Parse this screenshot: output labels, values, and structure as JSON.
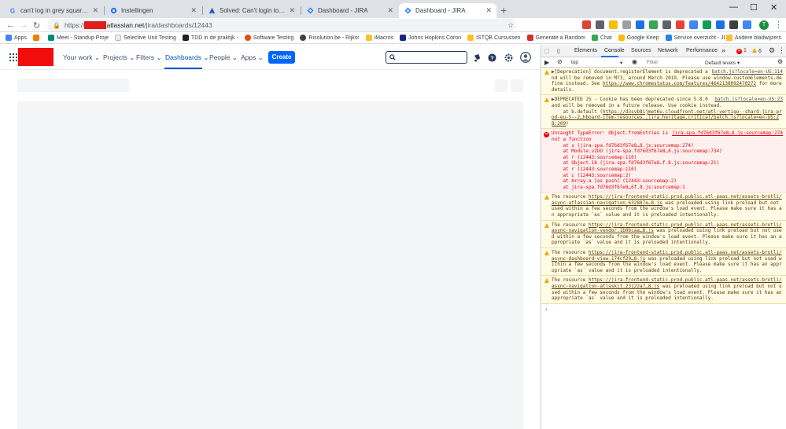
{
  "browser": {
    "tabs": [
      {
        "title": "can't log in grey squares atlassian",
        "favicon": "google-icon"
      },
      {
        "title": "Instellingen",
        "favicon": "gear-icon"
      },
      {
        "title": "Solved: Can't login to Jira (free w",
        "favicon": "atlassian-icon"
      },
      {
        "title": "Dashboard - JIRA",
        "favicon": "jira-icon"
      },
      {
        "title": "Dashboard - JIRA",
        "favicon": "jira-icon",
        "active": true
      }
    ],
    "url": {
      "scheme": "https://",
      "host_suffix": "atlassian.net",
      "path": "/jira/dashboards/12443"
    },
    "profile_initial": "T",
    "bookmarks": [
      {
        "label": "Apps",
        "color": "#4285f4"
      },
      {
        "label": "",
        "color": "#f57c00"
      },
      {
        "label": "Meet - Standup Proje",
        "color": "#00897b"
      },
      {
        "label": "Selective Unit Testing",
        "color": "#e8eaed"
      },
      {
        "label": "TDD in de praktijk -",
        "color": "#212121"
      },
      {
        "label": "Software Testing",
        "color": "#e64a19"
      },
      {
        "label": "Risolution.be - Rijksr",
        "color": "#424242"
      },
      {
        "label": "iMacros",
        "color": "#fbc02d"
      },
      {
        "label": "Johns Hopkins Coron",
        "color": "#1a237e"
      },
      {
        "label": "ISTQB Cursussen",
        "color": "#fbc02d"
      },
      {
        "label": "Generate a Random",
        "color": "#d32f2f"
      },
      {
        "label": "Chat",
        "color": "#34a853"
      },
      {
        "label": "Google Keep",
        "color": "#fbbc04"
      },
      {
        "label": "Service overzicht - JI",
        "color": "#1e88e5"
      }
    ],
    "other_bookmarks": "Andere bladwijzers"
  },
  "jira": {
    "menu": {
      "your_work": "Your work",
      "projects": "Projects",
      "filters": "Filters",
      "dashboards": "Dashboards",
      "people": "People",
      "apps": "Apps"
    },
    "create": "Create",
    "brand_color": "#0052cc"
  },
  "devtools": {
    "tabs": [
      "Elements",
      "Console",
      "Sources",
      "Network",
      "Performance"
    ],
    "active_tab": "Console",
    "more": "»",
    "error_count": "1",
    "warning_count": "6",
    "context": "top",
    "filter_placeholder": "Filter",
    "levels": "Default levels",
    "messages": [
      {
        "type": "warn",
        "source": "batch.js?locale=en-US:114",
        "text": "▶[Deprecation] document.registerElement is deprecated and will be removed in M73, around March 2019. Please use window.customElements.define instead. See ",
        "link": "https://www.chromestatus.com/features/4642138092470272",
        "tail": " for more details."
      },
      {
        "type": "warn",
        "source": "batch.js?locale=en-US:23",
        "text": "▶DEPRECATED JS - Cookie has been deprecated since 5.8.0 and will be removed in a future release. Use cookie instead.\n    at b.default (",
        "link": "https://d3svb8ijmet6u.cloudfront.net/atl-vertigo--shard-jira-prod-eu-5--2…hboard-item-resources.,jira.heritage.critical/batch.js?locale=en-US:28:209",
        "tail": ")"
      },
      {
        "type": "err",
        "source": "jira-spa.fd76d3f67e8…8.js:sourcemap:274",
        "text": "Uncaught TypeError: Object.fromEntries is not a function\n    at s (jira-spa.fd76d3f67e8…8.js:sourcemap:274)\n    at Module.vZUO (jira-spa.fd76d3f67e8…8.js:sourcemap:734)\n    at r (12443:sourcemap:110)\n    at Object.18 (jira-spa.fd76d3f67e8…f.8.js:sourcemap:21)\n    at r (12443:sourcemap:110)\n    at c (12443:sourcemap:2)\n    at Array.a [as push] (12443:sourcemap:2)\n    at jira-spa.fd76d3f67e8…6f.8.js:sourcemap:1",
        "link": "",
        "tail": ""
      },
      {
        "type": "warn",
        "source": "",
        "text": "The resource ",
        "link": "https://jira-frontend-static.prod.public.atl-paas.net/assets-brotli/async-atlassian-navigation.632887e…8.js",
        "tail": " was preloaded using link preload but not used within a few seconds from the window's load event. Please make sure it has an appropriate `as` value and it is preloaded intentionally."
      },
      {
        "type": "warn",
        "source": "",
        "text": "The resource ",
        "link": "https://jira-frontend-static.prod.public.atl-paas.net/assets-brotli/async-navigation-vendor.1b0bcaa…8.js",
        "tail": " was preloaded using link preload but not used within a few seconds from the window's load event. Please make sure it has an appropriate `as` value and it is preloaded intentionally."
      },
      {
        "type": "warn",
        "source": "",
        "text": "The resource ",
        "link": "https://jira-frontend-static.prod.public.atl-paas.net/assets-brotli/async-dashboard-view.174cf29…8.js",
        "tail": " was preloaded using link preload but not used within a few seconds from the window's load event. Please make sure it has an appropriate `as` value and it is preloaded intentionally."
      },
      {
        "type": "warn",
        "source": "",
        "text": "The resource ",
        "link": "https://jira-frontend-static.prod.public.atl-paas.net/assets-brotli/async-navigation-atlaskit.23122a7…8.js",
        "tail": " was preloaded using link preload but not used within a few seconds from the window's load event. Please make sure it has an appropriate `as` value and it is preloaded intentionally."
      }
    ],
    "prompt": "›"
  }
}
